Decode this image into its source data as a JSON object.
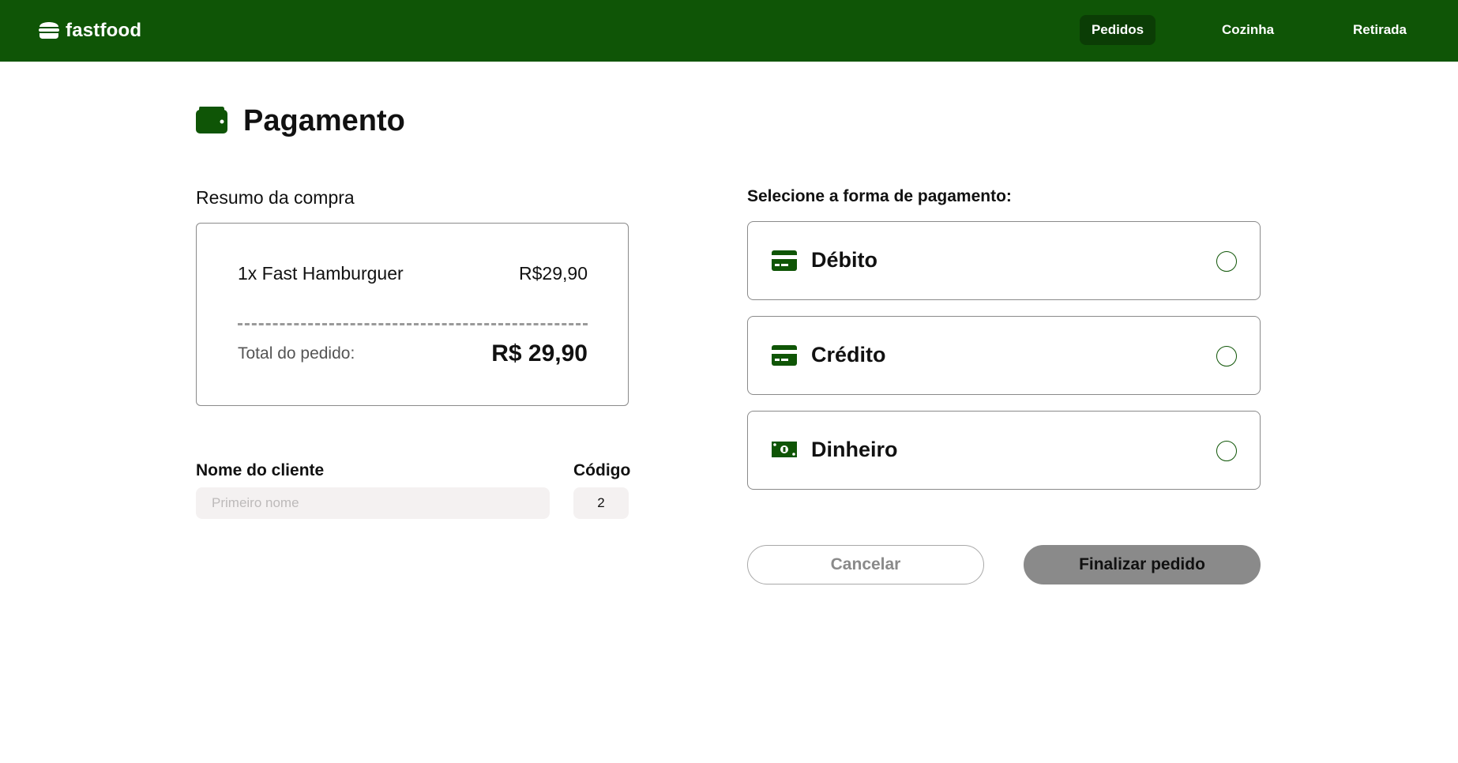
{
  "header": {
    "brand": "fastfood",
    "brand_icon": "burger-icon",
    "nav": [
      {
        "label": "Pedidos",
        "active": true
      },
      {
        "label": "Cozinha",
        "active": false
      },
      {
        "label": "Retirada",
        "active": false
      }
    ]
  },
  "page": {
    "title": "Pagamento",
    "title_icon": "wallet-icon"
  },
  "summary": {
    "label": "Resumo da compra",
    "items": [
      {
        "description": "1x Fast Hamburguer",
        "price": "R$29,90"
      }
    ],
    "total_label": "Total do pedido:",
    "total_value": "R$ 29,90"
  },
  "client": {
    "name_label": "Nome do cliente",
    "name_value": "",
    "name_placeholder": "Primeiro nome",
    "code_label": "Código",
    "code_value": "2"
  },
  "payment": {
    "label": "Selecione a forma de pagamento:",
    "options": [
      {
        "label": "Débito",
        "icon": "credit-card-icon",
        "selected": false
      },
      {
        "label": "Crédito",
        "icon": "credit-card-icon",
        "selected": false
      },
      {
        "label": "Dinheiro",
        "icon": "money-bill-icon",
        "selected": false
      }
    ]
  },
  "actions": {
    "cancel_label": "Cancelar",
    "finish_label": "Finalizar pedido"
  },
  "colors": {
    "brand_green": "#0f5506",
    "active_nav": "#0b3d05",
    "disabled_button": "#8a8a8a",
    "input_bg": "#f4f1f1"
  }
}
